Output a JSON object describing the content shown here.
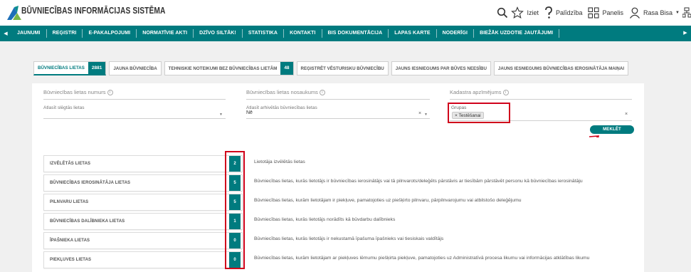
{
  "header": {
    "title": "BŪVNIECĪBAS INFORMĀCIJAS SISTĒMA",
    "logout_label": "Iziet",
    "help_label": "Palīdzība",
    "dashboard_label": "Panelis",
    "user_label": "Rasa Bisa"
  },
  "nav": {
    "items": [
      "JAUNUMI",
      "REĢISTRI",
      "E-PAKALPOJUMI",
      "NORMATĪVIE AKTI",
      "DZĪVO SILTĀK!",
      "STATISTIKA",
      "KONTAKTI",
      "BIS DOKUMENTĀCIJA",
      "LAPAS KARTE",
      "NODERĪGI",
      "BIEŽĀK UZDOTIE JAUTĀJUMI"
    ]
  },
  "tabs": [
    {
      "label": "BŪVNIECĪBAS LIETAS",
      "count": "2881"
    },
    {
      "label": "JAUNA BŪVNIECĪBA",
      "count": ""
    },
    {
      "label": "TEHNISKIE NOTEIKUMI BEZ BŪVNIECĪBAS LIETĀM",
      "count": "48"
    },
    {
      "label": "REĢISTRĒT VĒSTURISKU BŪVNIECĪBU",
      "count": ""
    },
    {
      "label": "JAUNS IESNIEGUMS PAR BŪVES NEESĪBU",
      "count": ""
    },
    {
      "label": "JAUNS IESNIEGUMS BŪVNIECĪBAS IEROSINĀTĀJA MAIŅAI",
      "count": ""
    }
  ],
  "search": {
    "case_number_label": "Būvniecības lietas numurs",
    "case_name_label": "Būvniecības lietas nosaukums",
    "cadastre_label": "Kadastra apzīmējums",
    "closed_cases_label": "Atlasīt slēgtās lietas",
    "archived_cases_label": "Atlasīt arhivētās būvniecības lietas",
    "archived_value": "Nē",
    "groups_label": "Grupas",
    "groups_chip": "× Testēšanai",
    "search_button": "MEKLĒT"
  },
  "lists": [
    {
      "label": "IZVĒLĒTĀS LIETAS",
      "count": "2",
      "desc": "Lietotāja izvēlētās lietas"
    },
    {
      "label": "BŪVNIECĪBAS IEROSINĀTĀJA LIETAS",
      "count": "5",
      "desc": "Būvniecības lietas, kurās lietotājs ir būvniecības ierosinātājs vai tā pilnvarots/deleģēts pārstāvis ar tiesībām pārstāvēt personu kā būvniecības ierosinātāju"
    },
    {
      "label": "PILNVARU LIETAS",
      "count": "5",
      "desc": "Būvniecības lietas, kurām lietotājam ir piekļuve, pamatojoties uz piešķirto pilnvaru, pārpilnvarojumu vai atbilstošo deleģējumu"
    },
    {
      "label": "BŪVNIECĪBAS DALĪBNIEKA LIETAS",
      "count": "1",
      "desc": "Būvniecības lietas, kurās lietotājs norādīts kā būvdarbu dalībnieks"
    },
    {
      "label": "ĪPAŠNIEKA LIETAS",
      "count": "0",
      "desc": "Būvniecības lietas, kurās lietotājs ir nekustamā īpašuma īpašnieks vai tiesiskais valdītājs"
    },
    {
      "label": "PIEKĻUVES LIETAS",
      "count": "0",
      "desc": "Būvniecības lietas, kurām lietotājam ar piekļuves lēmumu piešķirta piekļuve, pamatojoties uz Administratīvā procesa likumu vai informācijas atklātības likumu"
    }
  ],
  "colors": {
    "accent": "#007b7f",
    "highlight": "#d0021b"
  }
}
